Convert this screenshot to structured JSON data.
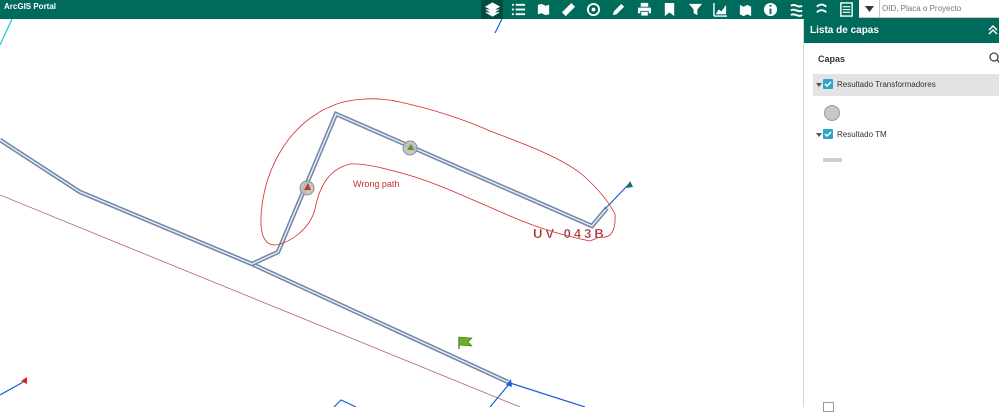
{
  "app": {
    "title": "ArcGIS Portal"
  },
  "toolbar": {
    "tools": [
      "layers-icon",
      "layer-list-icon",
      "basemap-icon",
      "measure-icon",
      "draw-icon",
      "pencil-icon",
      "print-icon",
      "bookmark-icon",
      "filter-icon",
      "chart-icon",
      "report-icon",
      "info-icon",
      "query-icon",
      "select-icon",
      "table-icon"
    ],
    "active_tool": "layers-icon"
  },
  "search": {
    "placeholder": "OID, Placa o Proyecto"
  },
  "map": {
    "annotation_text": "Wrong path",
    "feature_label": "UV 043B"
  },
  "panel": {
    "title": "Lista de capas",
    "section_label": "Capas",
    "layers": [
      {
        "name": "Resultado Transformadores",
        "checked": true,
        "selected": true,
        "legend": "gray-circle"
      },
      {
        "name": "Resultado TM",
        "checked": true,
        "selected": false,
        "legend": "gray-line"
      }
    ]
  },
  "colors": {
    "brand": "#006a5b",
    "checkbox": "#2aa6c8",
    "annotation": "#d42a2a",
    "route": "#6f87a8"
  }
}
